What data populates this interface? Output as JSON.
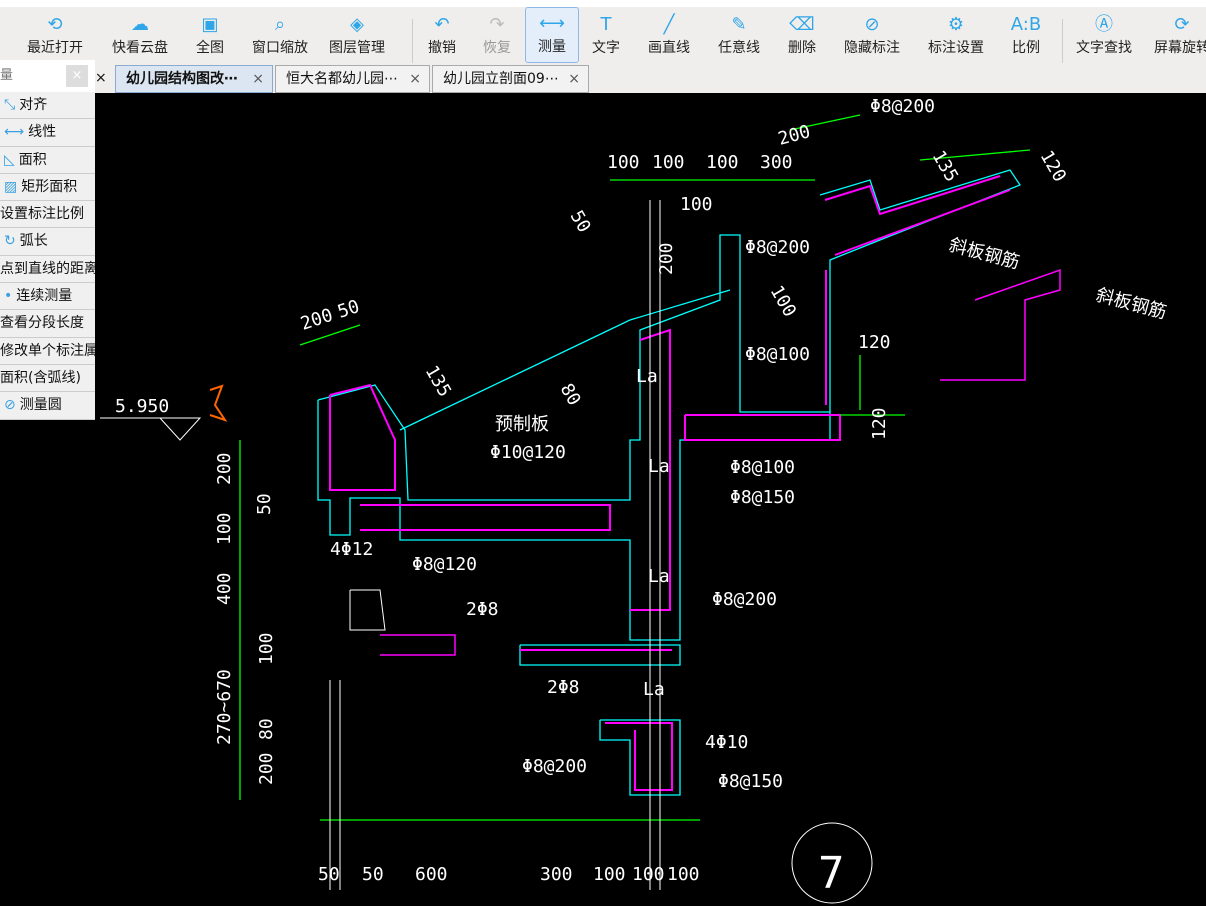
{
  "toolbar": {
    "items": [
      {
        "label": "最近打开",
        "icon": "history-icon"
      },
      {
        "label": "快看云盘",
        "icon": "cloud-icon"
      },
      {
        "label": "全图",
        "icon": "fit-all-icon"
      },
      {
        "label": "窗口缩放",
        "icon": "zoom-window-icon"
      },
      {
        "label": "图层管理",
        "icon": "layers-icon"
      },
      {
        "label": "撤销",
        "icon": "undo-icon"
      },
      {
        "label": "恢复",
        "icon": "redo-icon",
        "disabled": true
      },
      {
        "label": "测量",
        "icon": "ruler-icon",
        "active": true
      },
      {
        "label": "文字",
        "icon": "text-icon"
      },
      {
        "label": "画直线",
        "icon": "line-icon"
      },
      {
        "label": "任意线",
        "icon": "pen-icon"
      },
      {
        "label": "删除",
        "icon": "eraser-icon"
      },
      {
        "label": "隐藏标注",
        "icon": "eye-off-icon"
      },
      {
        "label": "标注设置",
        "icon": "annotation-settings-icon"
      },
      {
        "label": "比例",
        "icon": "scale-icon"
      },
      {
        "label": "文字查找",
        "icon": "text-search-icon"
      },
      {
        "label": "屏幕旋转",
        "icon": "rotate-screen-icon"
      }
    ]
  },
  "tabs": [
    {
      "label": "幼儿园结构图改⋯",
      "selected": true
    },
    {
      "label": "恒大名都幼儿园⋯"
    },
    {
      "label": "幼儿园立剖面09⋯"
    }
  ],
  "panel": {
    "search_placeholder": "量",
    "items": [
      {
        "label": "对齐"
      },
      {
        "label": "线性"
      },
      {
        "label": "面积"
      },
      {
        "label": "矩形面积"
      },
      {
        "label": "设置标注比例"
      },
      {
        "label": "弧长"
      },
      {
        "label": "点到直线的距离"
      },
      {
        "label": "连续测量"
      },
      {
        "label": "查看分段长度"
      },
      {
        "label": "修改单个标注属性"
      },
      {
        "label": "面积(含弧线)"
      },
      {
        "label": "测量圆"
      }
    ]
  },
  "drawing": {
    "labels": [
      "5.950",
      "200",
      "50",
      "135",
      "50",
      "80",
      "预制板",
      "Φ10@120",
      "Φ8@120",
      "4Φ12",
      "100",
      "100",
      "100",
      "300",
      "200",
      "100",
      "200",
      "Φ8@200",
      "100",
      "Φ8@100",
      "120",
      "120",
      "Φ8@200",
      "135",
      "120",
      "斜板钢筋",
      "斜板钢筋",
      "La",
      "La",
      "La",
      "La",
      "Φ8@100",
      "Φ8@150",
      "2Φ8",
      "Φ8@200",
      "2Φ8",
      "4Φ10",
      "Φ8@200",
      "Φ8@150",
      "200",
      "50",
      "100",
      "400",
      "100",
      "270~670",
      "80",
      "200",
      "50",
      "50",
      "600",
      "300",
      "100",
      "100",
      "100",
      "7"
    ],
    "colors": {
      "concrete": "#00ffff",
      "rebar": "#ff00ff",
      "dimension": "#00ff00",
      "text": "#ffffff",
      "markup": "#ff6600"
    }
  }
}
